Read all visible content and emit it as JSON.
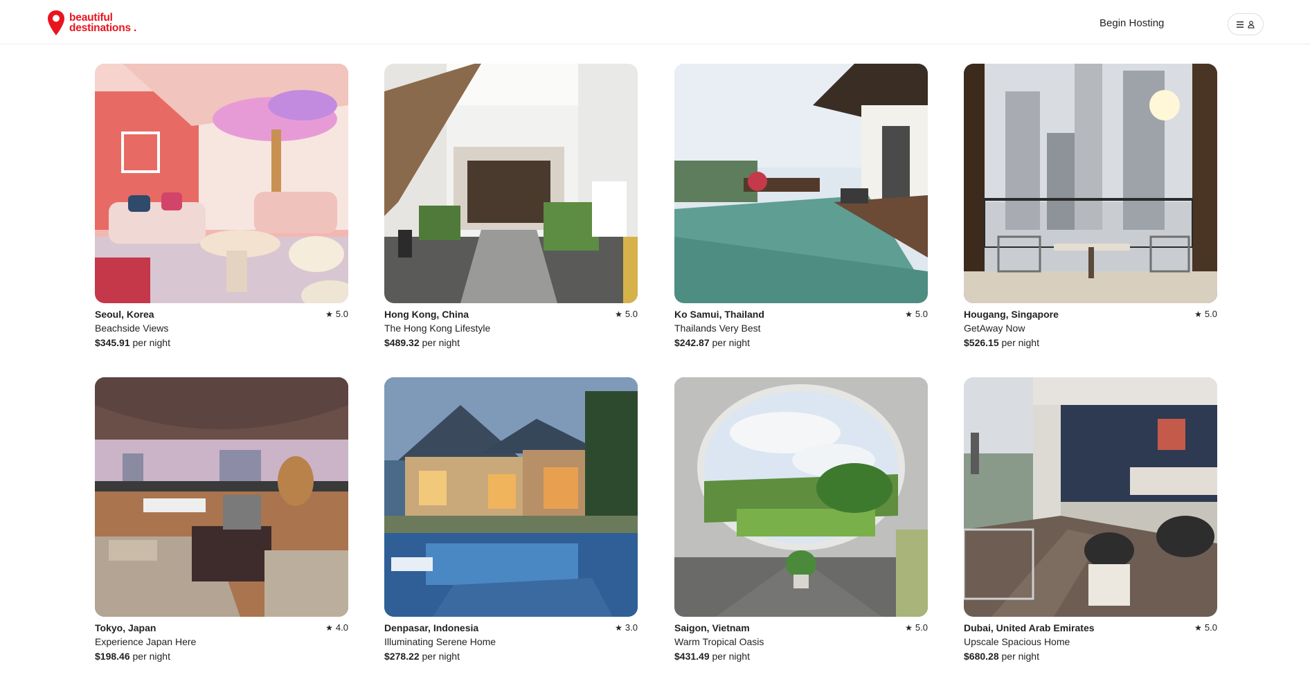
{
  "brand": {
    "line1": "beautiful",
    "line2": "destinations .",
    "accent": "#e8141e"
  },
  "header": {
    "host_label": "Begin Hosting",
    "menu_icon": "hamburger-icon",
    "user_icon": "user-icon"
  },
  "listings": [
    {
      "location": "Seoul, Korea",
      "rating": "5.0",
      "title": "Beachside Views",
      "price": "$345.91",
      "unit": "per night"
    },
    {
      "location": "Hong Kong, China",
      "rating": "5.0",
      "title": "The Hong Kong Lifestyle",
      "price": "$489.32",
      "unit": "per night"
    },
    {
      "location": "Ko Samui, Thailand",
      "rating": "5.0",
      "title": "Thailands Very Best",
      "price": "$242.87",
      "unit": "per night"
    },
    {
      "location": "Hougang, Singapore",
      "rating": "5.0",
      "title": "GetAway Now",
      "price": "$526.15",
      "unit": "per night"
    },
    {
      "location": "Tokyo, Japan",
      "rating": "4.0",
      "title": "Experience Japan Here",
      "price": "$198.46",
      "unit": "per night"
    },
    {
      "location": "Denpasar, Indonesia",
      "rating": "3.0",
      "title": "Illuminating Serene Home",
      "price": "$278.22",
      "unit": "per night"
    },
    {
      "location": "Saigon, Vietnam",
      "rating": "5.0",
      "title": "Warm Tropical Oasis",
      "price": "$431.49",
      "unit": "per night"
    },
    {
      "location": "Dubai, United Arab Emirates",
      "rating": "5.0",
      "title": "Upscale Spacious Home",
      "price": "$680.28",
      "unit": "per night"
    }
  ]
}
